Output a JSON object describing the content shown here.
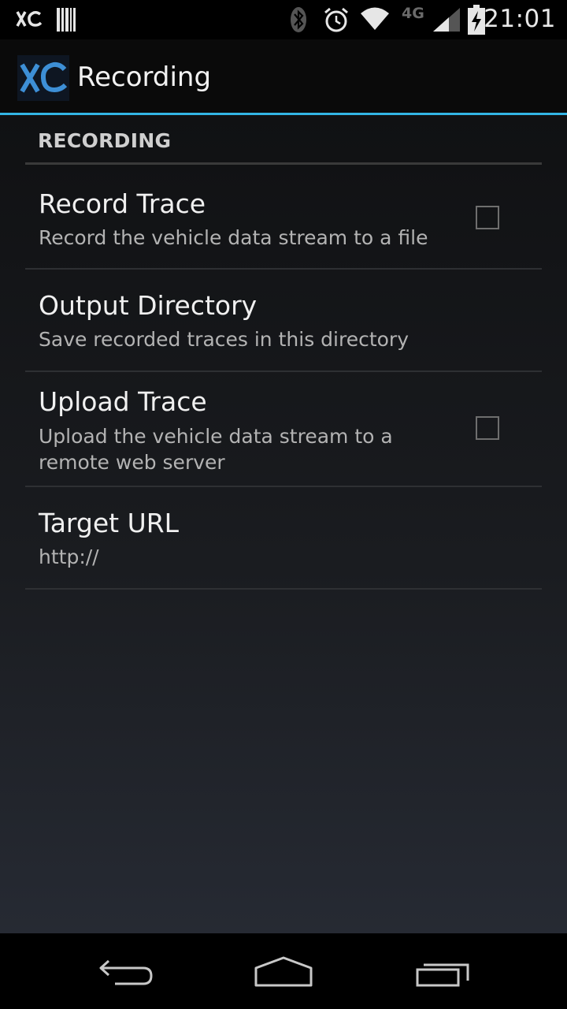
{
  "status_bar": {
    "time": "21:01",
    "network": "4G",
    "icons": [
      "xc-app-icon",
      "barcode-icon",
      "bluetooth-icon",
      "alarm-icon",
      "wifi-icon",
      "signal-icon",
      "battery-charging-icon"
    ]
  },
  "action_bar": {
    "title": "Recording",
    "logo_text": "XC",
    "accent_color": "#33b5e5"
  },
  "category": {
    "label": "RECORDING"
  },
  "preferences": [
    {
      "title": "Record Trace",
      "summary": "Record the vehicle data stream to a file",
      "has_checkbox": true,
      "checked": false
    },
    {
      "title": "Output Directory",
      "summary": "Save recorded traces in this directory",
      "has_checkbox": false
    },
    {
      "title": "Upload Trace",
      "summary": "Upload the vehicle data stream to a remote web server",
      "has_checkbox": true,
      "checked": false
    },
    {
      "title": "Target URL",
      "summary": "http://",
      "has_checkbox": false
    }
  ],
  "nav_bar": {
    "buttons": [
      "back-icon",
      "home-icon",
      "recent-apps-icon"
    ]
  }
}
